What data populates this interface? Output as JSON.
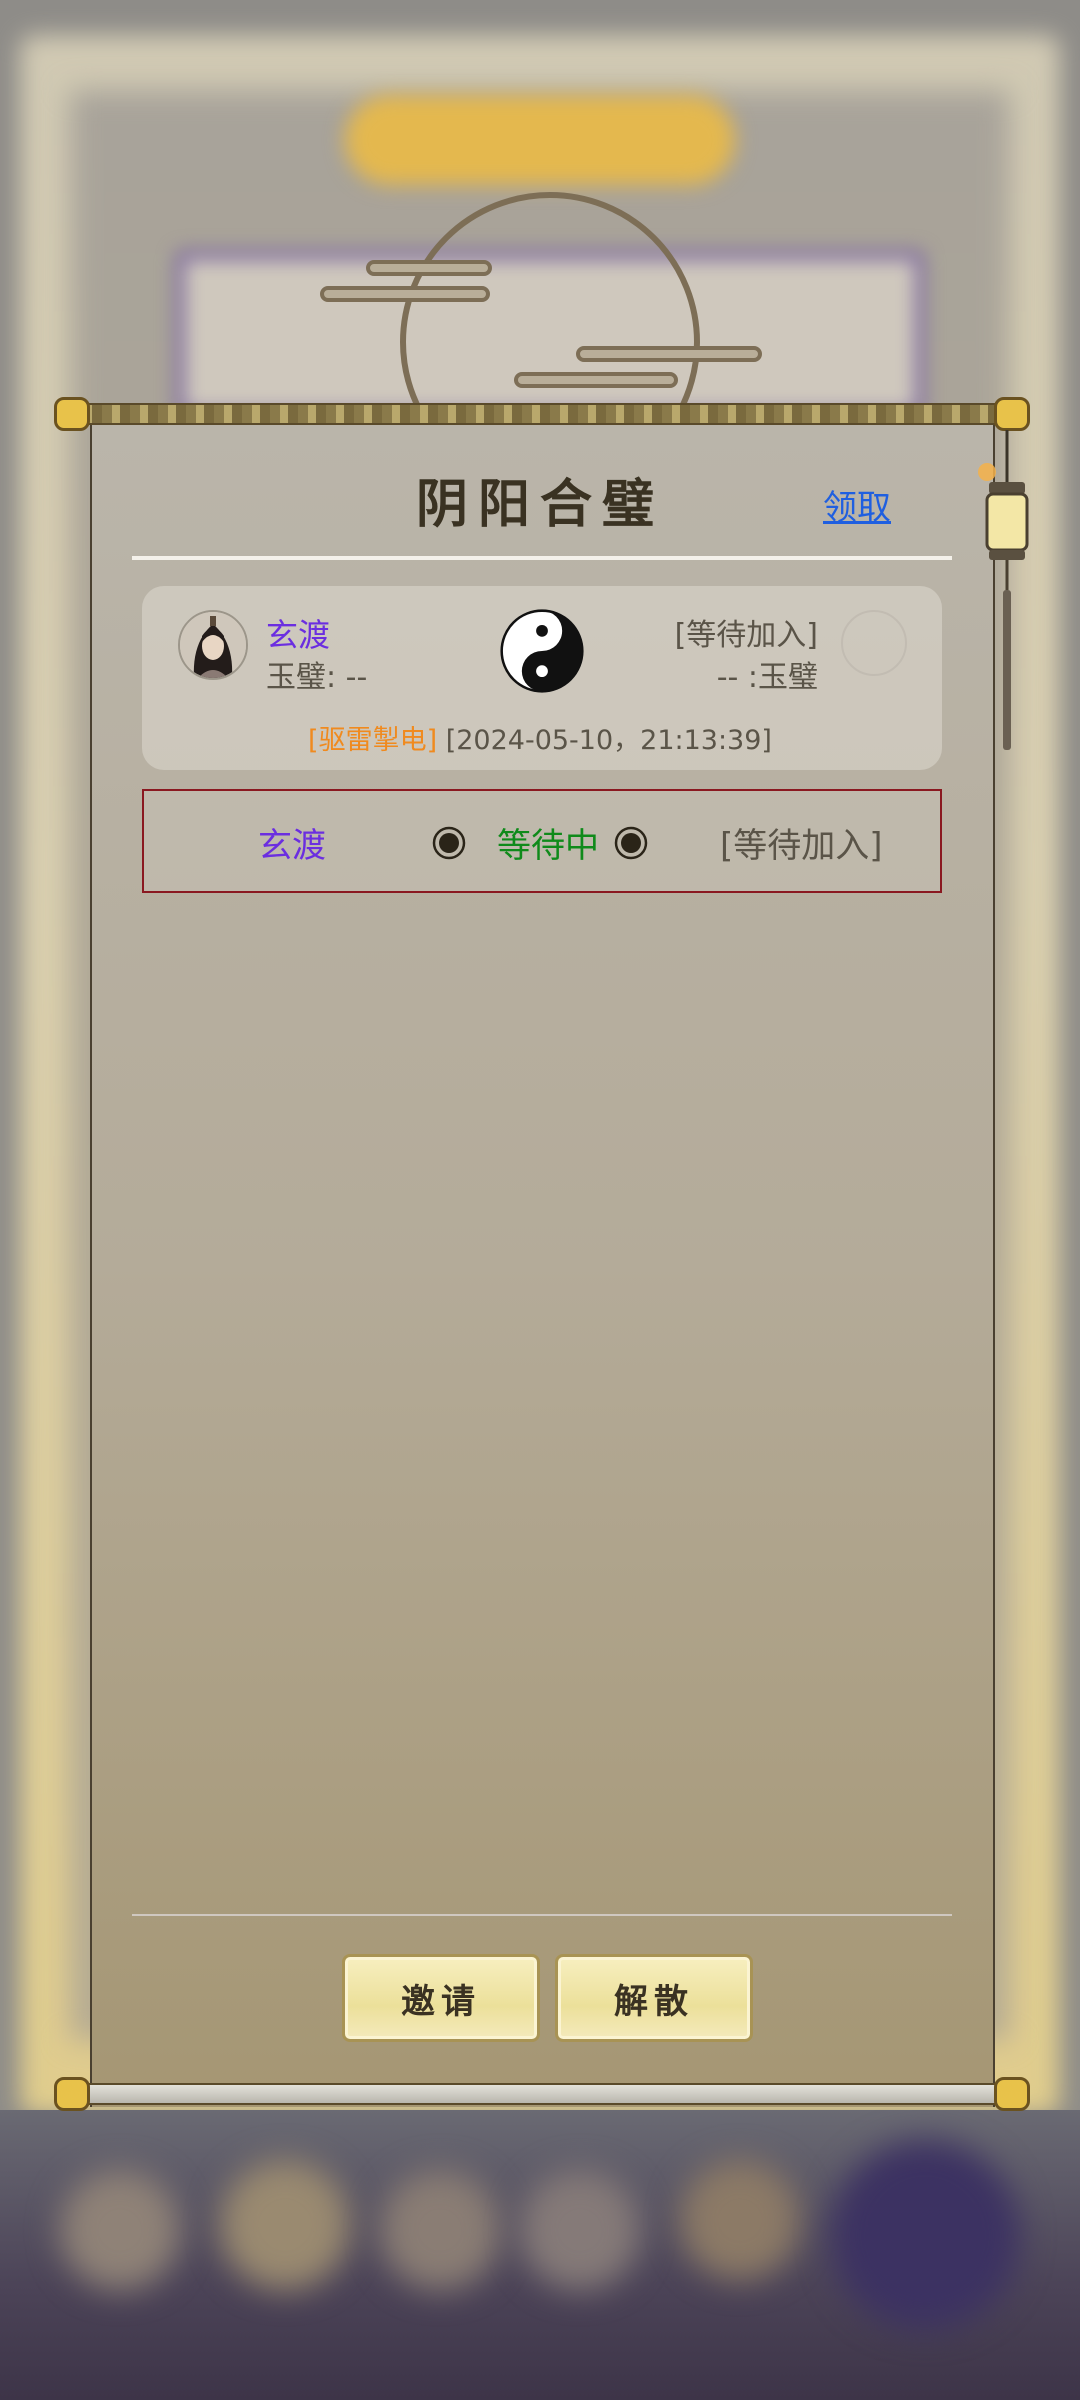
{
  "panel": {
    "title": "阴阳合璧",
    "claim_label": "领取"
  },
  "pairing": {
    "left_name": "玄渡",
    "left_jade": "玉璧: --",
    "right_name": "[等待加入]",
    "right_jade": "-- :玉璧",
    "skill_tag": "[驱雷掣电]",
    "timestamp": "[2024-05-10，21:13:39]"
  },
  "status": {
    "left_name": "玄渡",
    "state": "等待中",
    "right_name": "[等待加入]"
  },
  "buttons": {
    "invite": "邀请",
    "disband": "解散"
  },
  "colors": {
    "name_purple": "#6b2ee0",
    "waiting_green": "#0f8a1a",
    "skill_orange": "#f08a1e",
    "link_blue": "#1f5fe0"
  }
}
